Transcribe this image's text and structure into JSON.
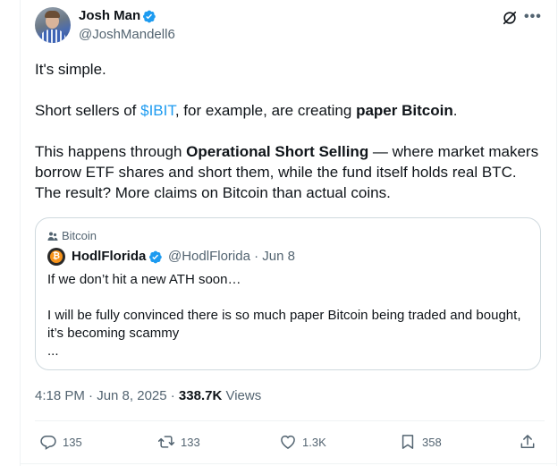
{
  "author": {
    "name": "Josh Man",
    "handle": "@JoshMandell6"
  },
  "post": {
    "line1": "It's simple.",
    "p2_before": "Short sellers of ",
    "p2_cashtag": "$IBIT",
    "p2_middle": ", for example, are creating ",
    "p2_bold": "paper Bitcoin",
    "p2_after": ".",
    "p3_before": "This happens through ",
    "p3_bold": "Operational Short Selling",
    "p3_after": " — where market makers borrow ETF shares and short them, while the fund itself holds real BTC. The result? More claims on Bitcoin than actual coins."
  },
  "quote": {
    "community": "Bitcoin",
    "name": "HodlFlorida",
    "handle_date": "@HodlFlorida · Jun 8",
    "line1": "If we don’t hit a new ATH soon…",
    "line2": "I will be fully convinced there is so much paper Bitcoin being traded and bought, it’s becoming scammy",
    "line3": "..."
  },
  "meta": {
    "time_date": "4:18 PM · Jun 8, 2025 · ",
    "views_count": "338.7K",
    "views_label": " Views"
  },
  "actions": {
    "replies": "135",
    "reposts": "133",
    "likes": "1.3K",
    "bookmarks": "358"
  },
  "icons": {
    "verified": "verified-badge-icon",
    "grok": "grok-icon",
    "more": "more-icon",
    "reply": "reply-icon",
    "repost": "repost-icon",
    "like": "heart-icon",
    "bookmark": "bookmark-icon",
    "share": "share-icon",
    "community": "community-icon"
  },
  "colors": {
    "link": "#1d9bf0",
    "verified": "#1d9bf0",
    "secondary_text": "#536471",
    "border": "#cfd9de"
  }
}
